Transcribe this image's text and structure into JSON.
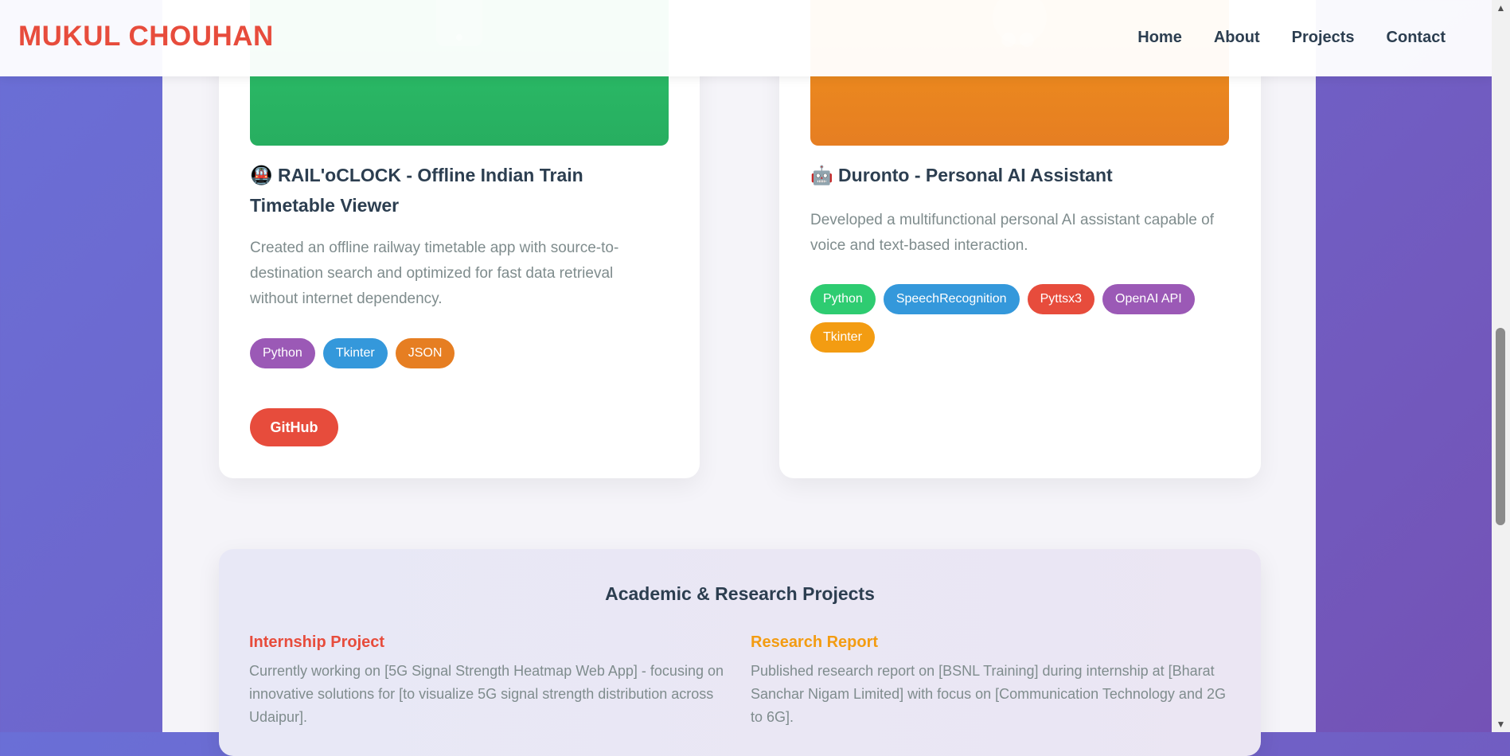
{
  "brand": "MUKUL CHOUHAN",
  "nav": [
    "Home",
    "About",
    "Projects",
    "Contact"
  ],
  "projects": [
    {
      "icon": "🚇",
      "title": "RAIL'oCLOCK - Offline Indian Train Timetable Viewer",
      "description": "Created an offline railway timetable app with source-to-destination search and optimized for fast data retrieval without internet dependency.",
      "tags": [
        {
          "label": "Python",
          "color": "#9b59b6"
        },
        {
          "label": "Tkinter",
          "color": "#3498db"
        },
        {
          "label": "JSON",
          "color": "#e67e22"
        }
      ],
      "button": "GitHub"
    },
    {
      "icon": "🤖",
      "title": "Duronto - Personal AI Assistant",
      "description": "Developed a multifunctional personal AI assistant capable of voice and text-based interaction.",
      "tags": [
        {
          "label": "Python",
          "color": "#2ecc71"
        },
        {
          "label": "SpeechRecognition",
          "color": "#3498db"
        },
        {
          "label": "Pyttsx3",
          "color": "#e74c3c"
        },
        {
          "label": "OpenAI API",
          "color": "#9b59b6"
        },
        {
          "label": "Tkinter",
          "color": "#f39c12"
        }
      ]
    }
  ],
  "academic": {
    "title": "Academic & Research Projects",
    "items": [
      {
        "heading": "Internship Project",
        "color": "#e74c3c",
        "text": "Currently working on [5G Signal Strength Heatmap Web App] - focusing on innovative solutions for [to visualize 5G signal strength distribution across Udaipur]."
      },
      {
        "heading": "Research Report",
        "color": "#f39c12",
        "text": "Published research report on [BSNL Training] during internship at [Bharat Sanchar Nigam Limited] with focus on [Communication Technology and 2G to 6G]."
      }
    ]
  }
}
